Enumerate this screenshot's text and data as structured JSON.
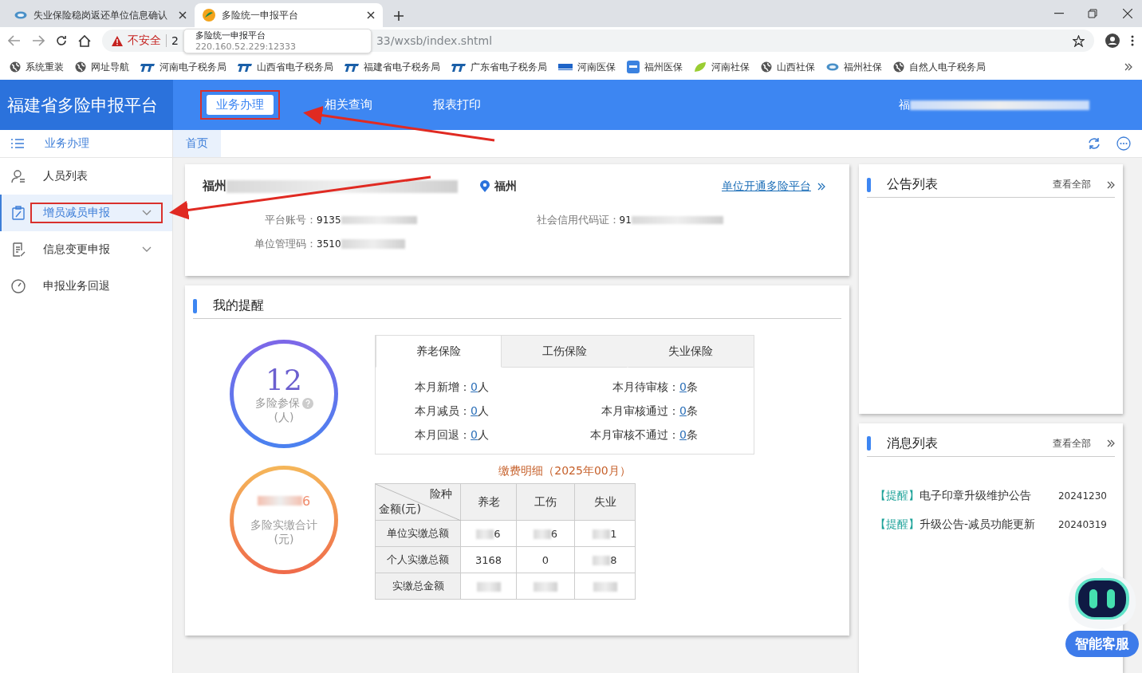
{
  "browser": {
    "tabs": [
      {
        "title": "失业保险稳岗返还单位信息确认",
        "selected": false
      },
      {
        "title": "多险统一申报平台",
        "selected": true
      }
    ],
    "security": "不安全",
    "address": {
      "prefix": "2",
      "suffix": "33/wxsb/index.shtml"
    },
    "tooltip": {
      "title": "多险统一申报平台",
      "url": "220.160.52.229:12333"
    },
    "bookmarks": [
      {
        "label": "系统重装",
        "kind": "globe"
      },
      {
        "label": "网址导航",
        "kind": "globe"
      },
      {
        "label": "河南电子税务局",
        "kind": "tax"
      },
      {
        "label": "山西省电子税务局",
        "kind": "tax"
      },
      {
        "label": "福建省电子税务局",
        "kind": "tax"
      },
      {
        "label": "广东省电子税务局",
        "kind": "tax"
      },
      {
        "label": "河南医保",
        "kind": "medical"
      },
      {
        "label": "福州医保",
        "kind": "medicalbox"
      },
      {
        "label": "河南社保",
        "kind": "leaf"
      },
      {
        "label": "山西社保",
        "kind": "globe"
      },
      {
        "label": "福州社保",
        "kind": "social"
      },
      {
        "label": "自然人电子税务局",
        "kind": "globe"
      }
    ]
  },
  "header": {
    "title": "福建省多险申报平台",
    "nav": [
      {
        "label": "业务办理",
        "selected": true,
        "highlighted": true
      },
      {
        "label": "相关查询",
        "selected": false,
        "highlighted": false
      },
      {
        "label": "报表打印",
        "selected": false,
        "highlighted": false
      }
    ],
    "user": "福"
  },
  "sidebar": {
    "heading": "业务办理",
    "items": [
      {
        "label": "人员列表",
        "kind": "person",
        "selected": false,
        "expandable": false,
        "highlighted": false
      },
      {
        "label": "增员减员申报",
        "kind": "clipboard",
        "selected": true,
        "expandable": true,
        "highlighted": true
      },
      {
        "label": "信息变更申报",
        "kind": "doc",
        "selected": false,
        "expandable": true,
        "highlighted": false
      },
      {
        "label": "申报业务回退",
        "kind": "gauge",
        "selected": false,
        "expandable": false,
        "highlighted": false
      }
    ]
  },
  "breadcrumb": [
    {
      "label": "首页",
      "selected": true
    }
  ],
  "unit": {
    "name": "福州",
    "city": "福州",
    "link": "单位开通多险平台",
    "fields": [
      {
        "label": "平台账号：",
        "value": "9135"
      },
      {
        "label": "社会信用代码证：",
        "value": "91"
      },
      {
        "label": "单位管理码：",
        "value": "3510"
      }
    ]
  },
  "reminders": {
    "title": "我的提醒",
    "insured": {
      "value": "12",
      "label": "多险参保",
      "unit": "(人)"
    },
    "paid": {
      "value": "6",
      "label": "多险实缴合计",
      "unit": "(元)"
    },
    "tabs": [
      {
        "label": "养老保险",
        "selected": true
      },
      {
        "label": "工伤保险",
        "selected": false
      },
      {
        "label": "失业保险",
        "selected": false
      }
    ],
    "stats": [
      {
        "label": "本月新增：",
        "value": "0",
        "unit": "人"
      },
      {
        "label": "本月待审核：",
        "value": "0",
        "unit": "条"
      },
      {
        "label": "本月减员：",
        "value": "0",
        "unit": "人"
      },
      {
        "label": "本月审核通过：",
        "value": "0",
        "unit": "条"
      },
      {
        "label": "本月回退：",
        "value": "0",
        "unit": "人"
      },
      {
        "label": "本月审核不通过：",
        "value": "0",
        "unit": "条"
      }
    ],
    "table_title": "缴费明细（2025年00月）",
    "table": {
      "corner_top": "险种",
      "corner_bottom": "金额(元)",
      "columns": [
        "养老",
        "工伤",
        "失业"
      ],
      "rows": [
        {
          "label": "单位实缴总额",
          "cells": [
            {
              "text": "6",
              "blurred": true
            },
            {
              "text": "6",
              "blurred": true
            },
            {
              "text": "1",
              "blurred": true
            }
          ]
        },
        {
          "label": "个人实缴总额",
          "cells": [
            {
              "text": "3168",
              "blurred": false
            },
            {
              "text": "0",
              "blurred": false
            },
            {
              "text": "8",
              "blurred": true
            }
          ]
        },
        {
          "label": "实缴总金额",
          "cells": [
            {
              "blurred": true
            },
            {
              "blurred": true
            },
            {
              "blurred": true
            }
          ]
        }
      ]
    }
  },
  "notices": {
    "title": "公告列表",
    "more": "查看全部"
  },
  "messages": {
    "title": "消息列表",
    "more": "查看全部",
    "items": [
      {
        "tag": "【提醒】",
        "text": "电子印章升级维护公告",
        "date": "20241230"
      },
      {
        "tag": "【提醒】",
        "text": "升级公告-减员功能更新",
        "date": "20240319"
      }
    ]
  },
  "assistant": {
    "label": "智能客服"
  }
}
